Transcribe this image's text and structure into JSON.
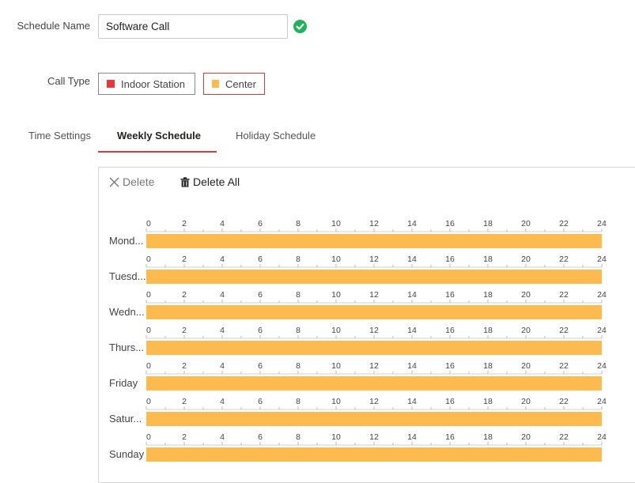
{
  "form": {
    "schedule_name_label": "Schedule Name",
    "schedule_name_value": "Software Call",
    "call_type_label": "Call Type",
    "call_types": [
      {
        "label": "Indoor Station",
        "color": "#e8363b"
      },
      {
        "label": "Center",
        "color": "#fdba4f"
      }
    ],
    "selected_call_type": "Center"
  },
  "tabs": [
    {
      "label": "Time Settings"
    },
    {
      "label": "Weekly Schedule",
      "active": true
    },
    {
      "label": "Holiday Schedule"
    }
  ],
  "toolbar": {
    "delete_label": "Delete",
    "delete_all_label": "Delete All"
  },
  "schedule": {
    "tick_labels": [
      "0",
      "2",
      "4",
      "6",
      "8",
      "10",
      "12",
      "14",
      "16",
      "18",
      "20",
      "22",
      "24"
    ],
    "hours_max": 24,
    "bar_color": "#fdba4f",
    "days": [
      {
        "label": "Mond...",
        "start": 0,
        "end": 24
      },
      {
        "label": "Tuesd...",
        "start": 0,
        "end": 24
      },
      {
        "label": "Wedn...",
        "start": 0,
        "end": 24
      },
      {
        "label": "Thurs...",
        "start": 0,
        "end": 24
      },
      {
        "label": "Friday",
        "start": 0,
        "end": 24
      },
      {
        "label": "Satur...",
        "start": 0,
        "end": 24
      },
      {
        "label": "Sunday",
        "start": 0,
        "end": 24
      }
    ]
  },
  "colors": {
    "accent": "#d43b3b",
    "success": "#1fb25a"
  }
}
